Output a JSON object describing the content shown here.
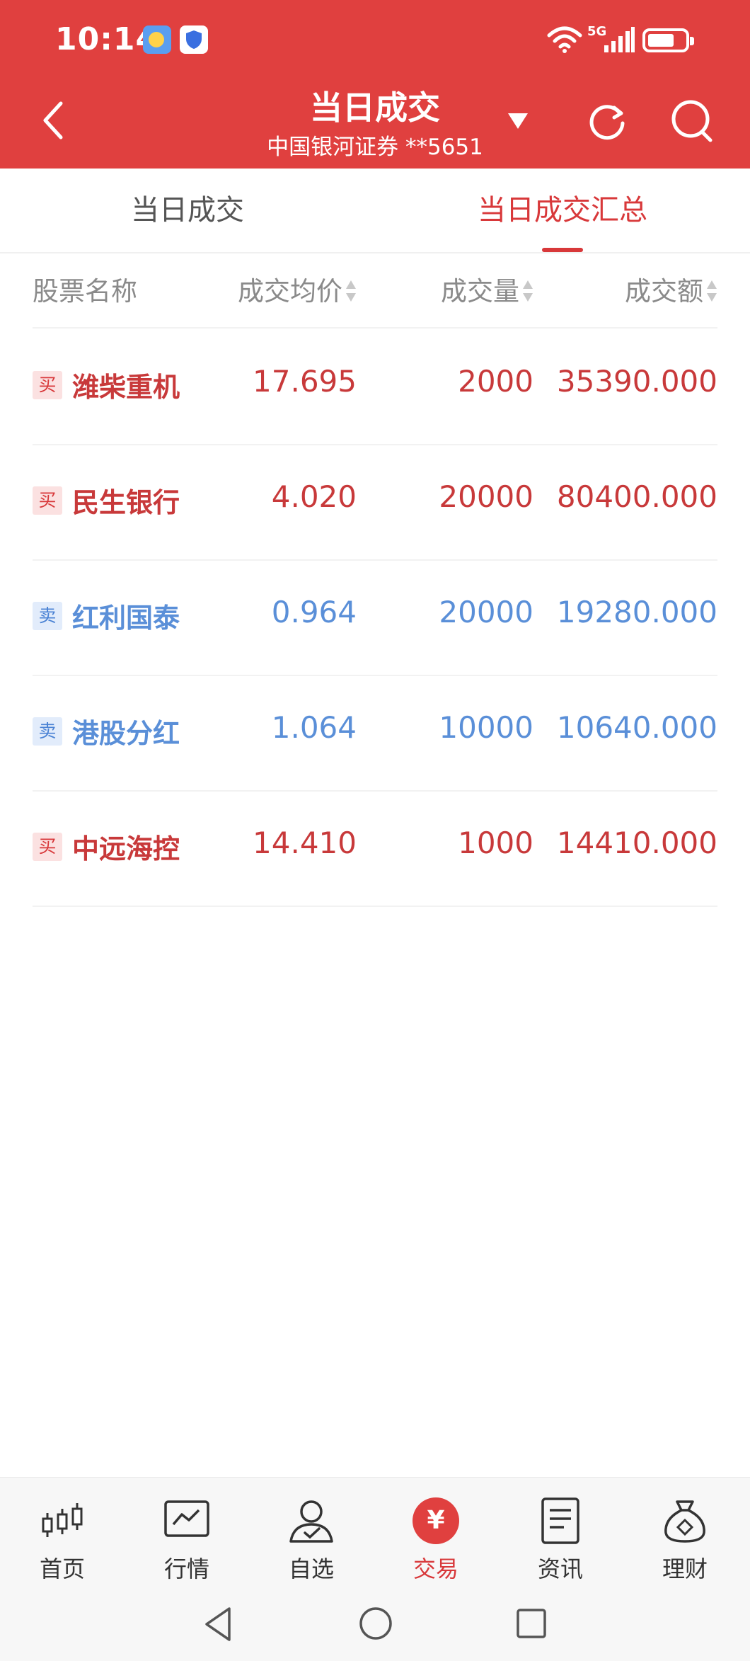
{
  "status_bar": {
    "time": "10:14",
    "network": "5G"
  },
  "header": {
    "title": "当日成交",
    "subtitle": "中国银河证券 **5651",
    "accent_color": "#e0403f"
  },
  "tabs": [
    {
      "label": "当日成交",
      "active": false
    },
    {
      "label": "当日成交汇总",
      "active": true
    }
  ],
  "table": {
    "headers": {
      "name": "股票名称",
      "price": "成交均价",
      "volume": "成交量",
      "amount": "成交额"
    },
    "rows": [
      {
        "side": "买",
        "name": "潍柴重机",
        "price": "17.695",
        "volume": "2000",
        "amount": "35390.000"
      },
      {
        "side": "买",
        "name": "民生银行",
        "price": "4.020",
        "volume": "20000",
        "amount": "80400.000"
      },
      {
        "side": "卖",
        "name": "红利国泰",
        "price": "0.964",
        "volume": "20000",
        "amount": "19280.000"
      },
      {
        "side": "卖",
        "name": "港股分红",
        "price": "1.064",
        "volume": "10000",
        "amount": "10640.000"
      },
      {
        "side": "买",
        "name": "中远海控",
        "price": "14.410",
        "volume": "1000",
        "amount": "14410.000"
      }
    ],
    "buy_color": "#c8393a",
    "sell_color": "#5a8fd8"
  },
  "bottom_nav": [
    {
      "label": "首页",
      "icon": "candlestick-icon"
    },
    {
      "label": "行情",
      "icon": "chart-icon"
    },
    {
      "label": "自选",
      "icon": "user-check-icon"
    },
    {
      "label": "交易",
      "icon": "yen-icon",
      "symbol": "¥",
      "active": true
    },
    {
      "label": "资讯",
      "icon": "document-icon"
    },
    {
      "label": "理财",
      "icon": "money-bag-icon"
    }
  ]
}
